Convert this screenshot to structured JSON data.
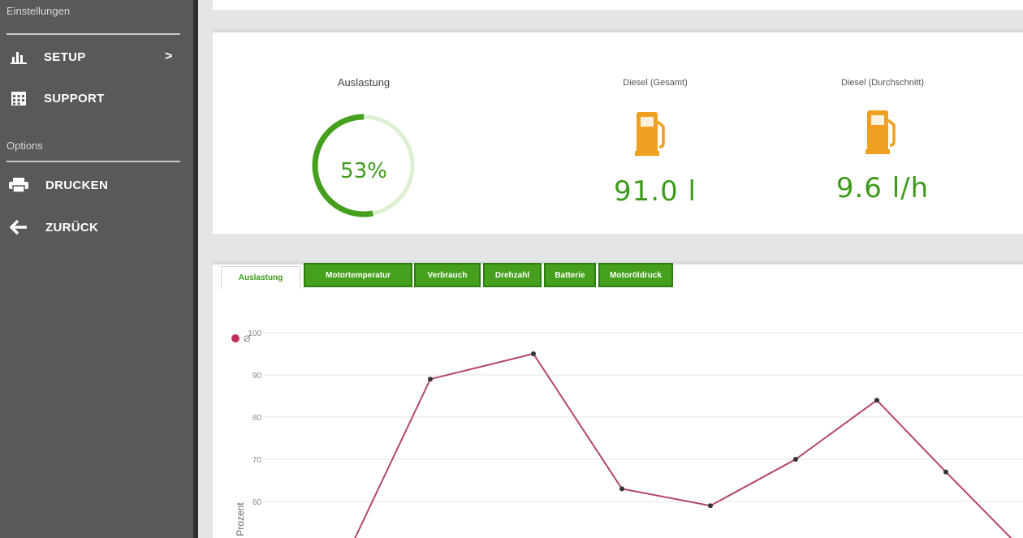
{
  "sidebar": {
    "section_settings": "Einstellungen",
    "section_options": "Options",
    "items": [
      {
        "label": "SETUP",
        "chevron": ">"
      },
      {
        "label": "SUPPORT"
      },
      {
        "label": "DRUCKEN"
      },
      {
        "label": "ZURÜCK"
      }
    ]
  },
  "stats": {
    "load_title": "Auslastung",
    "load_value": "53%",
    "load_fraction": 0.53,
    "diesel_total_title": "Diesel (Gesamt)",
    "diesel_total_value": "91.0 l",
    "diesel_avg_title": "Diesel (Durchschnitt)",
    "diesel_avg_value": "9.6 l/h"
  },
  "tabs": [
    {
      "label": "Auslastung",
      "active": true
    },
    {
      "label": "Motortemperatur",
      "active": false
    },
    {
      "label": "Verbrauch",
      "active": false
    },
    {
      "label": "Drehzahl",
      "active": false
    },
    {
      "label": "Batterie",
      "active": false
    },
    {
      "label": "Motoröldruck",
      "active": false
    }
  ],
  "colors": {
    "accent_green": "#45a01d",
    "gauge_track": "#dcefd2",
    "pump_orange": "#f0a020",
    "series_line": "#b3456b",
    "sidebar_bg": "#58595b"
  },
  "icons": [
    "bar-chart-icon",
    "calendar-grid-icon",
    "printer-icon",
    "arrow-left-icon",
    "fuel-pump-icon"
  ],
  "chart_data": {
    "type": "line",
    "ylabel": "Prozent",
    "ylim": [
      50,
      100
    ],
    "yticks": [
      "100",
      "90",
      "80",
      "70",
      "60"
    ],
    "series": [
      {
        "name": "Ø",
        "x": [
          0,
          1,
          2,
          3,
          4,
          5,
          6,
          7,
          8
        ],
        "values": [
          50,
          89,
          95,
          63,
          59,
          70,
          84,
          67,
          50
        ]
      }
    ],
    "grid": true,
    "legend": "top-left"
  }
}
